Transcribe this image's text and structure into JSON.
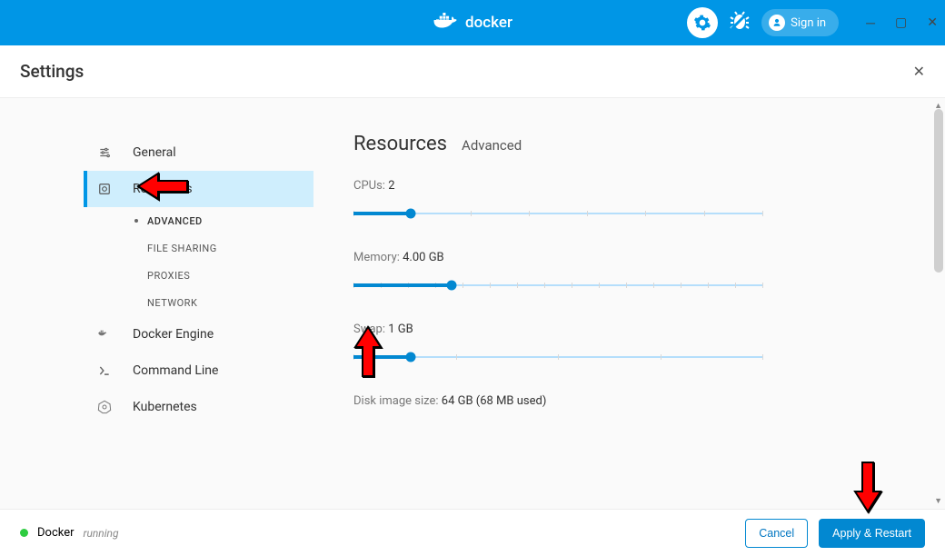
{
  "header": {
    "app_name": "docker",
    "signin_label": "Sign in"
  },
  "settings": {
    "title": "Settings"
  },
  "sidebar": {
    "items": [
      {
        "label": "General",
        "icon": "sliders"
      },
      {
        "label": "Resources",
        "icon": "resources",
        "active": true
      },
      {
        "label": "Docker Engine",
        "icon": "engine"
      },
      {
        "label": "Command Line",
        "icon": "cli"
      },
      {
        "label": "Kubernetes",
        "icon": "k8s"
      }
    ],
    "sub_items": [
      {
        "label": "ADVANCED",
        "active": true
      },
      {
        "label": "FILE SHARING"
      },
      {
        "label": "PROXIES"
      },
      {
        "label": "NETWORK"
      }
    ]
  },
  "main": {
    "heading": "Resources",
    "subtitle": "Advanced",
    "fields": {
      "cpus": {
        "label": "CPUs:",
        "value": "2",
        "fill_pct": 14,
        "ticks": 7
      },
      "memory": {
        "label": "Memory:",
        "value": "4.00 GB",
        "fill_pct": 24,
        "ticks": 15
      },
      "swap": {
        "label": "Swap:",
        "value": "1 GB",
        "fill_pct": 14,
        "ticks": 4
      },
      "disk": {
        "label": "Disk image size:",
        "value": "64 GB (68 MB used)"
      }
    }
  },
  "footer": {
    "status_name": "Docker",
    "status_state": "running",
    "cancel_label": "Cancel",
    "apply_label": "Apply & Restart"
  }
}
